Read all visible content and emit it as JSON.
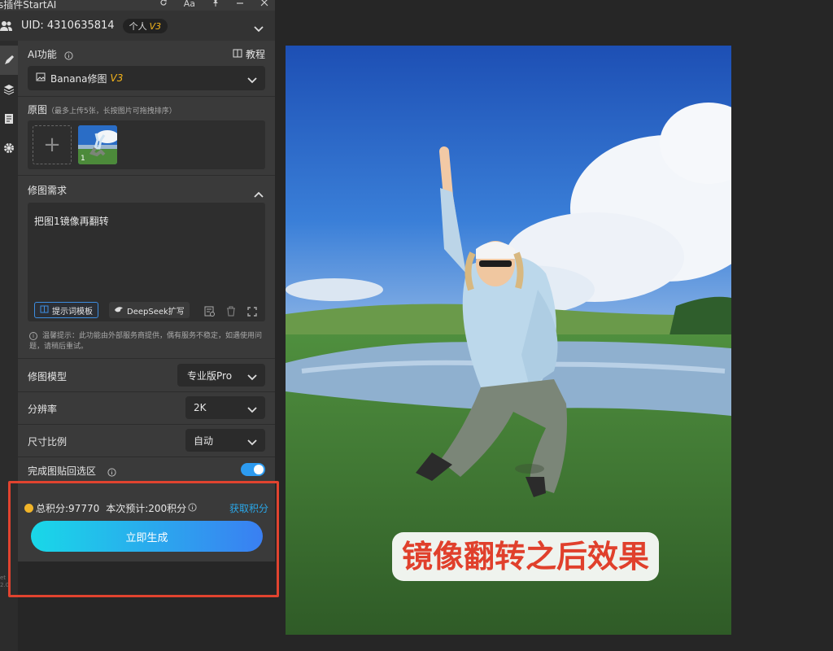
{
  "window": {
    "title": "s插件StartAI"
  },
  "titlebar_icons": [
    "refresh-icon",
    "font-icon",
    "pin-icon",
    "minimize-icon",
    "close-icon"
  ],
  "titlebar_font_label": "Aa",
  "user": {
    "uid": "UID: 4310635814",
    "badge": "个人",
    "badge_version": "V3"
  },
  "left_tools": [
    "brush-icon",
    "layers-icon",
    "document-icon",
    "gear-icon"
  ],
  "version_text": "et\n2.0",
  "ai_function": {
    "label": "AI功能",
    "tutorial": "教程",
    "selected": "Banana修图",
    "selected_version": "V3"
  },
  "original": {
    "label": "原图",
    "hint": "（最多上传5张，长按图片可拖拽排序）",
    "thumb_number": "1"
  },
  "edit_request": {
    "label": "修图需求",
    "text": "把图1镜像再翻转",
    "template_chip": "提示词模板",
    "deepseek_chip": "DeepSeek扩写"
  },
  "tip": "温馨提示：此功能由外部服务商提供，偶有服务不稳定，如遇使用问题，请稍后重试。",
  "settings": {
    "model_label": "修图模型",
    "model_value": "专业版Pro",
    "resolution_label": "分辨率",
    "resolution_value": "2K",
    "ratio_label": "尺寸比例",
    "ratio_value": "自动",
    "paste_back_label": "完成图贴回选区",
    "paste_back_on": true
  },
  "footer": {
    "total_points": "总积分:97770",
    "estimate": "本次预计:200积分",
    "get_points": "获取积分",
    "generate": "立即生成"
  },
  "annotation": "镜像翻转之后效果",
  "colors": {
    "accent_blue": "#2d9bf0",
    "gradient_start": "#19d8e8",
    "gradient_end": "#3a7ff2",
    "annotation_red": "#e0402c",
    "v3_gold": "#f5b51b"
  }
}
